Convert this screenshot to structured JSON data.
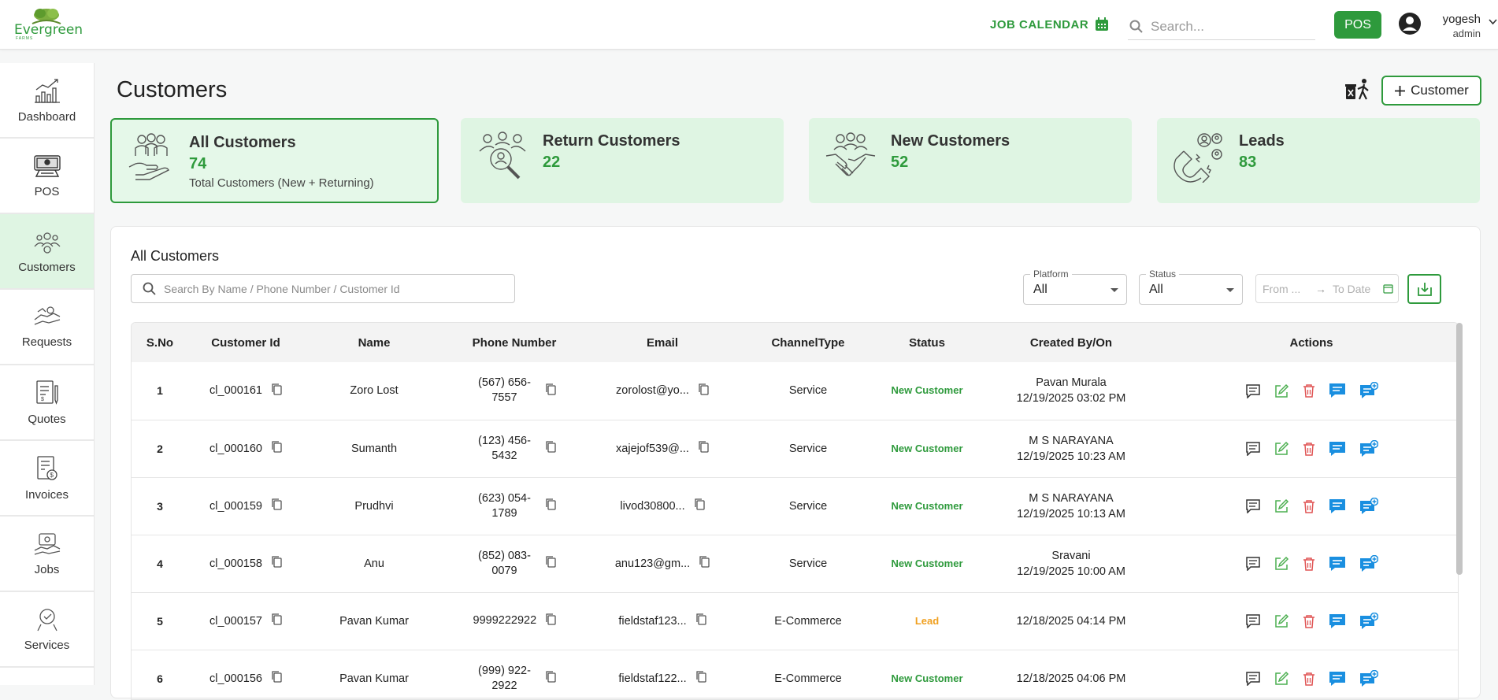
{
  "header": {
    "logo_text": "Evergreen",
    "logo_sub": "FARMS",
    "job_calendar_label": "JOB CALENDAR",
    "search_placeholder": "Search...",
    "pos_label": "POS",
    "user_name": "yogesh",
    "user_role": "admin"
  },
  "sidebar": {
    "items": [
      {
        "label": "Dashboard",
        "icon": "chart-icon"
      },
      {
        "label": "POS",
        "icon": "pos-terminal-icon"
      },
      {
        "label": "Customers",
        "icon": "customers-icon",
        "active": true
      },
      {
        "label": "Requests",
        "icon": "requests-icon"
      },
      {
        "label": "Quotes",
        "icon": "quotes-icon"
      },
      {
        "label": "Invoices",
        "icon": "invoice-icon"
      },
      {
        "label": "Jobs",
        "icon": "jobs-icon"
      },
      {
        "label": "Services",
        "icon": "services-icon"
      }
    ]
  },
  "page": {
    "title": "Customers",
    "add_button_label": "Customer"
  },
  "cards": [
    {
      "title": "All Customers",
      "value": "74",
      "desc": "Total Customers (New + Returning)"
    },
    {
      "title": "Return Customers",
      "value": "22"
    },
    {
      "title": "New Customers",
      "value": "52"
    },
    {
      "title": "Leads",
      "value": "83"
    }
  ],
  "panel": {
    "title": "All Customers",
    "search_placeholder": "Search By Name / Phone Number / Customer Id",
    "platform_label": "Platform",
    "platform_value": "All",
    "status_label": "Status",
    "status_value": "All",
    "date_from_placeholder": "From ...",
    "date_to_placeholder": "To Date"
  },
  "table": {
    "headers": [
      "S.No",
      "Customer Id",
      "Name",
      "Phone Number",
      "Email",
      "ChannelType",
      "Status",
      "Created By/On",
      "Actions"
    ],
    "rows": [
      {
        "sno": "1",
        "id": "cl_000161",
        "name": "Zoro Lost",
        "phone": "(567) 656-7557",
        "email": "zorolost@yo...",
        "channel": "Service",
        "status": "New Customer",
        "by": "Pavan Murala",
        "on": "12/19/2025 03:02 PM"
      },
      {
        "sno": "2",
        "id": "cl_000160",
        "name": "Sumanth",
        "phone": "(123) 456-5432",
        "email": "xajejof539@...",
        "channel": "Service",
        "status": "New Customer",
        "by": "M S NARAYANA",
        "on": "12/19/2025 10:23 AM"
      },
      {
        "sno": "3",
        "id": "cl_000159",
        "name": "Prudhvi",
        "phone": "(623) 054-1789",
        "email": "livod30800...",
        "channel": "Service",
        "status": "New Customer",
        "by": "M S NARAYANA",
        "on": "12/19/2025 10:13 AM"
      },
      {
        "sno": "4",
        "id": "cl_000158",
        "name": "Anu",
        "phone": "(852) 083-0079",
        "email": "anu123@gm...",
        "channel": "Service",
        "status": "New Customer",
        "by": "Sravani",
        "on": "12/19/2025 10:00 AM"
      },
      {
        "sno": "5",
        "id": "cl_000157",
        "name": "Pavan Kumar",
        "phone": "9999222922",
        "email": "fieldstaf123...",
        "channel": "E-Commerce",
        "status": "Lead",
        "by": "",
        "on": "12/18/2025 04:14 PM"
      },
      {
        "sno": "6",
        "id": "cl_000156",
        "name": "Pavan Kumar",
        "phone": "(999) 922-2922",
        "email": "fieldstaf122...",
        "channel": "E-Commerce",
        "status": "New Customer",
        "by": "",
        "on": "12/18/2025 04:06 PM"
      }
    ]
  },
  "colors": {
    "accent": "#2e9a3c",
    "card_bg": "#dff5e3",
    "lead": "#f0a020",
    "delete": "#e05555",
    "chat_blue": "#1a8fe0"
  }
}
